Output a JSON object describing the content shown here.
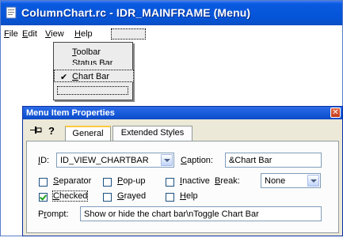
{
  "window": {
    "title": "ColumnChart.rc - IDR_MAINFRAME (Menu)"
  },
  "menubar": {
    "items": [
      {
        "pre": "",
        "u": "F",
        "post": "ile"
      },
      {
        "pre": "",
        "u": "E",
        "post": "dit"
      },
      {
        "pre": "",
        "u": "V",
        "post": "iew"
      },
      {
        "pre": "",
        "u": "H",
        "post": "elp"
      }
    ]
  },
  "dropdown": {
    "items": [
      {
        "u": "T",
        "post": "oolbar"
      },
      {
        "u": "S",
        "post": "tatus Bar"
      },
      {
        "u": "C",
        "post": "hart Bar"
      }
    ],
    "checked_mark": "✔"
  },
  "properties": {
    "title": "Menu Item Properties",
    "close_glyph": "✕",
    "help_glyph": "?",
    "tabs": [
      "General",
      "Extended Styles"
    ],
    "id_label": {
      "u": "I",
      "post": "D:"
    },
    "id_value": "ID_VIEW_CHARTBAR",
    "caption_label": {
      "u": "C",
      "post": "aption:"
    },
    "caption_value": "&Chart Bar",
    "checks": {
      "separator": {
        "u": "S",
        "post": "eparator",
        "checked": false
      },
      "popup": {
        "pre": "",
        "u": "P",
        "post": "op-up",
        "checked": false
      },
      "inactive": {
        "u": "I",
        "post": "nactive",
        "checked": false
      },
      "checked": {
        "pre": "",
        "u": "C",
        "post": "hecked",
        "checked": true
      },
      "grayed": {
        "u": "G",
        "post": "rayed",
        "checked": false
      },
      "help": {
        "u": "H",
        "post": "elp",
        "checked": false
      }
    },
    "break_label": {
      "u": "B",
      "post": "reak:"
    },
    "break_value": "None",
    "prompt_label": {
      "pre": "P",
      "u": "r",
      "post": "ompt:"
    },
    "prompt_value": "Show or hide the chart bar\\nToggle Chart Bar"
  },
  "colors": {
    "titlebar": "#0554d8",
    "dialog_bg": "#ece9d8",
    "check_green": "#21a121"
  }
}
